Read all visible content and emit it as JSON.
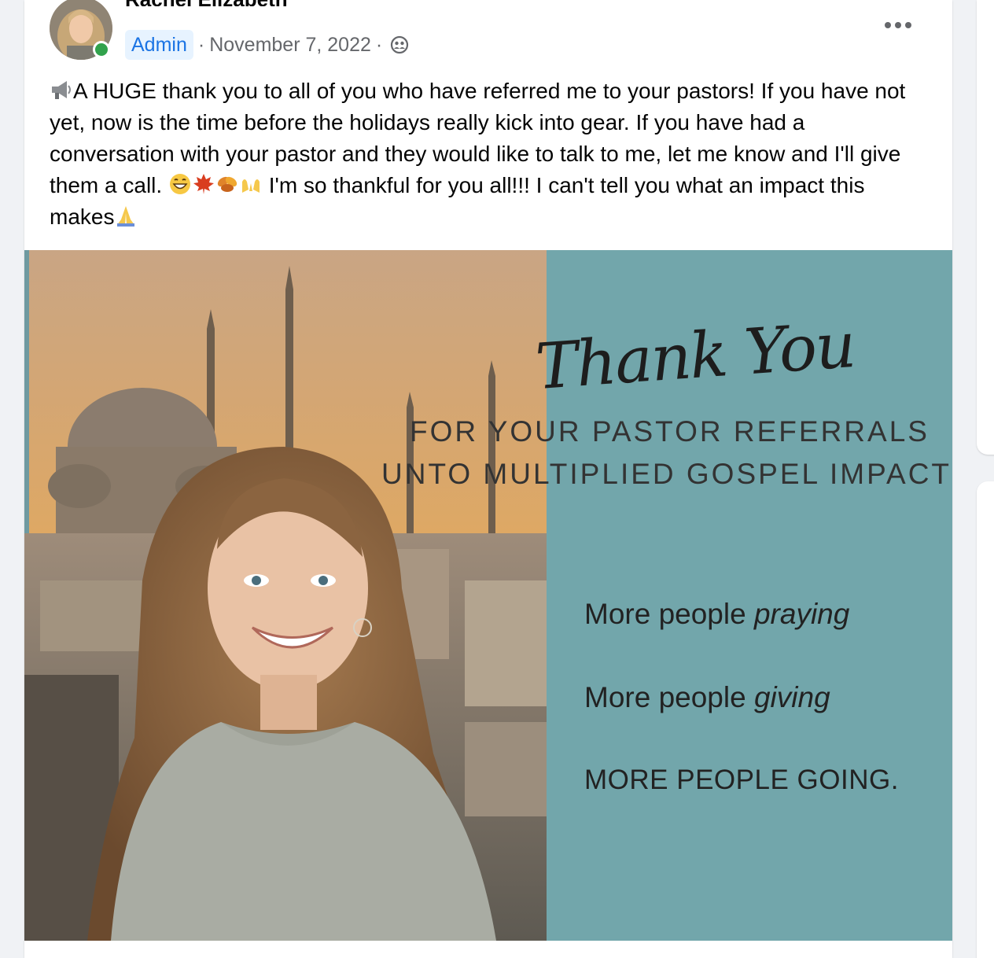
{
  "post": {
    "author_name": "Rachel Elizabeth",
    "role_badge": "Admin",
    "separator": "·",
    "date": "November 7, 2022",
    "text_lines": [
      "A HUGE thank you to all of you who have referred me to your pastors! If you have not yet, now is the time before the holidays really kick into gear. If you have had a conversation with your pastor and they would like to talk to me, let me know and I'll give them a call.",
      " I'm so thankful for you all!!! I can't tell you what an impact this makes"
    ],
    "icons": {
      "more": "more-horizontal-icon",
      "privacy": "group-members-icon",
      "leading_emoji": "megaphone",
      "inline_emojis": [
        "grinning-face",
        "maple-leaf",
        "fallen-leaves",
        "raising-hands"
      ],
      "trailing_emoji": "folded-hands"
    }
  },
  "image": {
    "title_script": "Thank You",
    "subline_1": "FOR YOUR PASTOR REFERRALS",
    "subline_2": "UNTO MULTIPLIED GOSPEL IMPACT",
    "bullet_1_prefix": "More people ",
    "bullet_1_emph": "praying",
    "bullet_2_prefix": "More people ",
    "bullet_2_emph": "giving",
    "bullet_3": "MORE PEOPLE GOING.",
    "teal_color": "#72a6ab"
  },
  "colors": {
    "accent_blue": "#1b74e4",
    "badge_bg": "#e7f3ff",
    "online_green": "#31a24c",
    "meta_gray": "#65676b"
  }
}
